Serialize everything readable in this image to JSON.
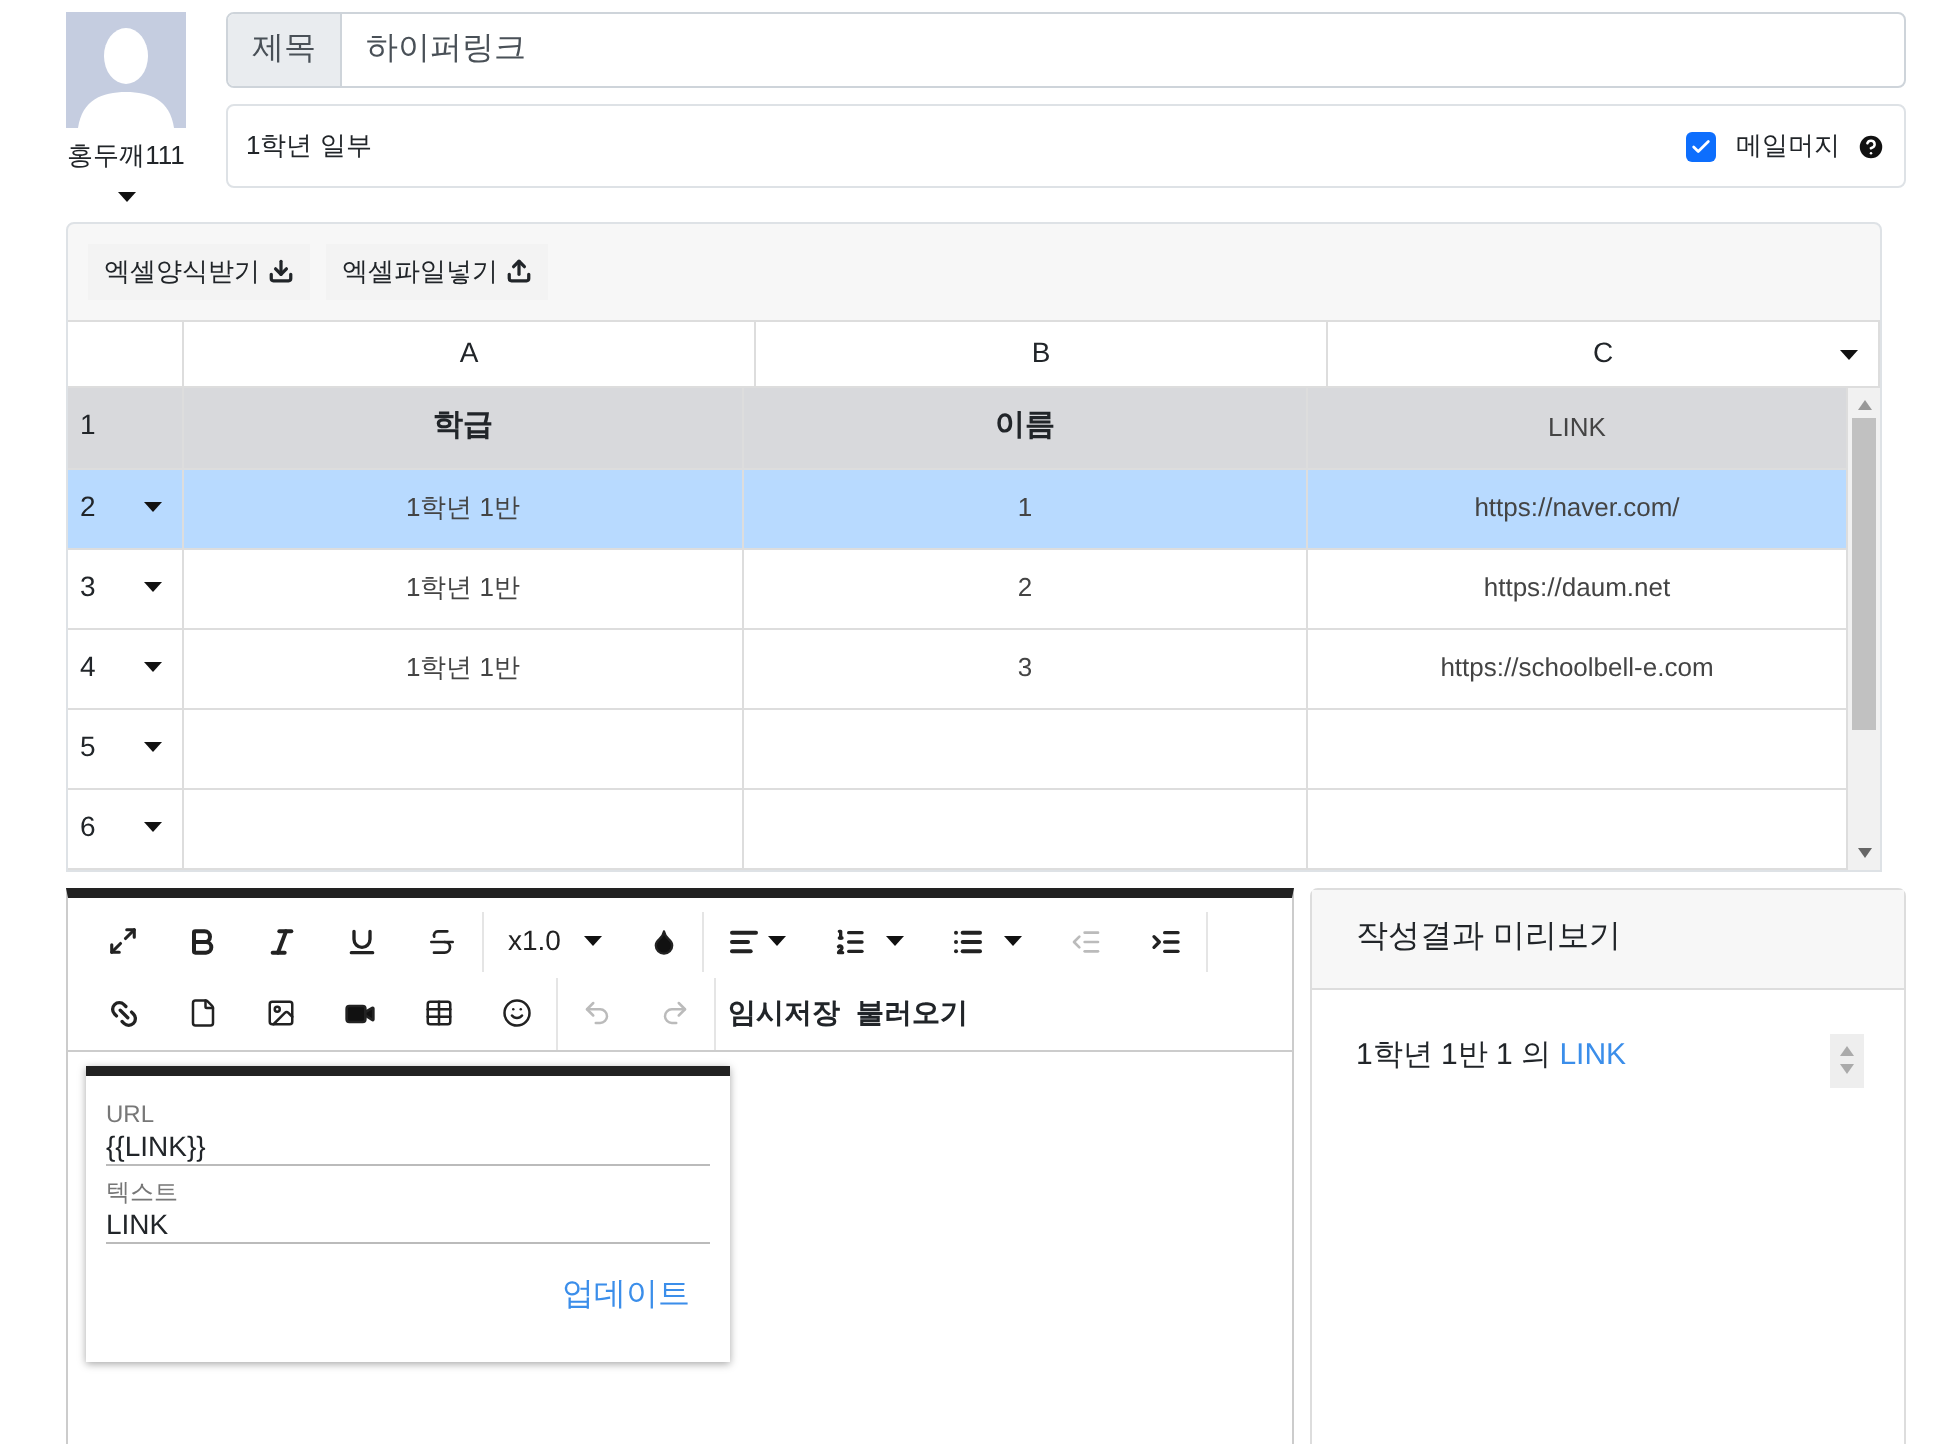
{
  "user": {
    "name": "홍두깨111"
  },
  "title_field": {
    "label": "제목",
    "value": "하이퍼링크"
  },
  "subtitle_field": {
    "value": "1학년 일부"
  },
  "mail_merge": {
    "label": "메일머지",
    "checked": true
  },
  "excel_buttons": [
    "엑셀양식받기",
    "엑셀파일넣기"
  ],
  "sheet": {
    "columns": [
      "A",
      "B",
      "C"
    ],
    "rows": [
      {
        "number": "1",
        "kind": "header",
        "selected": false,
        "cells": [
          "학급",
          "이름",
          "LINK"
        ]
      },
      {
        "number": "2",
        "kind": "data",
        "selected": true,
        "cells": [
          "1학년 1반",
          "1",
          "https://naver.com/"
        ]
      },
      {
        "number": "3",
        "kind": "data",
        "selected": false,
        "cells": [
          "1학년 1반",
          "2",
          "https://daum.net"
        ]
      },
      {
        "number": "4",
        "kind": "data",
        "selected": false,
        "cells": [
          "1학년 1반",
          "3",
          "https://schoolbell-e.com"
        ]
      },
      {
        "number": "5",
        "kind": "data",
        "selected": false,
        "cells": []
      },
      {
        "number": "6",
        "kind": "data",
        "selected": false,
        "cells": []
      }
    ]
  },
  "editor": {
    "font_size": "x1.0",
    "outdent_disabled": true,
    "undo_disabled": true,
    "redo_disabled": true,
    "temp_save": "임시저장",
    "load": "불러오기",
    "link_popover": {
      "url_label": "URL",
      "url_value": "{{LINK}}",
      "text_label": "텍스트",
      "text_value": "LINK",
      "update": "업데이트"
    }
  },
  "preview": {
    "title": "작성결과 미리보기",
    "text": "1학년 1반 1 의 ",
    "link": "LINK"
  }
}
